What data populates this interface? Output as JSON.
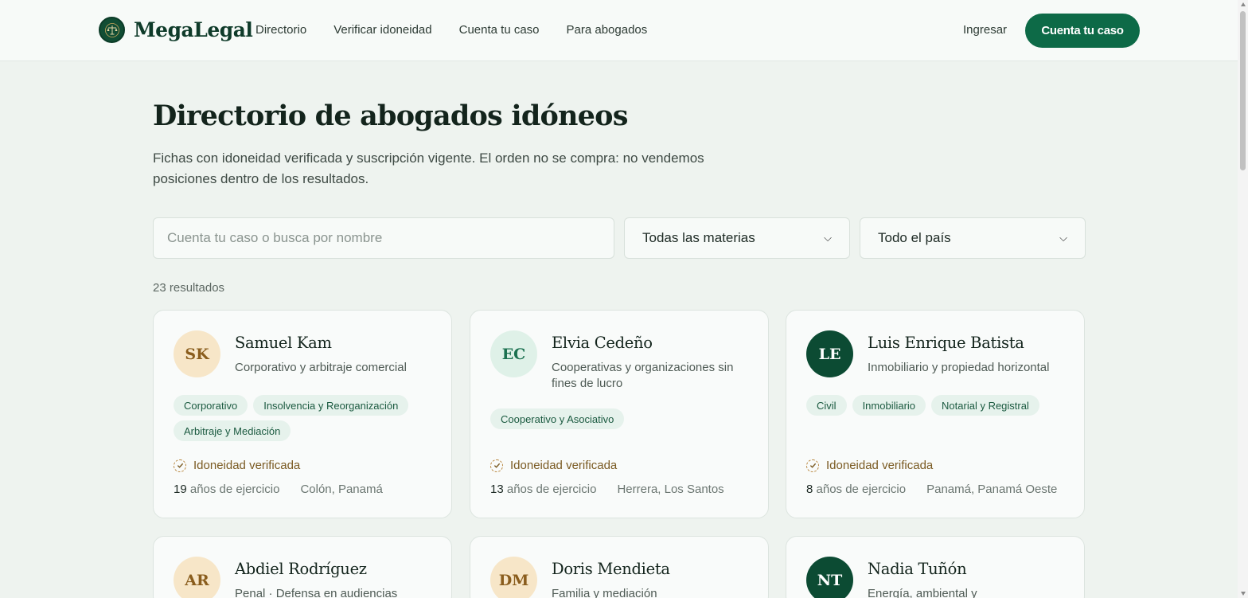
{
  "header": {
    "brand": "MegaLegal",
    "nav": [
      "Directorio",
      "Verificar idoneidad",
      "Cuenta tu caso",
      "Para abogados"
    ],
    "login": "Ingresar",
    "cta": "Cuenta tu caso"
  },
  "main": {
    "title": "Directorio de abogados idóneos",
    "subtitle": "Fichas con idoneidad verificada y suscripción vigente. El orden no se compra: no vendemos posiciones dentro de los resultados.",
    "search_placeholder": "Cuenta tu caso o busca por nombre",
    "materias_selected": "Todas las materias",
    "pais_selected": "Todo el país",
    "results_count": "23 resultados"
  },
  "verified_label": "Idoneidad verificada",
  "years_suffix": "años de ejercicio",
  "lawyers": [
    {
      "initials": "SK",
      "name": "Samuel Kam",
      "specialty": "Corporativo y arbitraje comercial",
      "tags": [
        "Corporativo",
        "Insolvencia y Reorganización",
        "Arbitraje y Mediación"
      ],
      "years": "19",
      "location": "Colón, Panamá",
      "avatar_color": "#f7e6c8"
    },
    {
      "initials": "EC",
      "name": "Elvia Cedeño",
      "specialty": "Cooperativas y organizaciones sin fines de lucro",
      "tags": [
        "Cooperativo y Asociativo"
      ],
      "years": "13",
      "location": "Herrera, Los Santos",
      "avatar_color": "#dff1e8"
    },
    {
      "initials": "LE",
      "name": "Luis Enrique Batista",
      "specialty": "Inmobiliario y propiedad horizontal",
      "tags": [
        "Civil",
        "Inmobiliario",
        "Notarial y Registral"
      ],
      "years": "8",
      "location": "Panamá, Panamá Oeste",
      "avatar_color": "#0c4b33"
    },
    {
      "initials": "AR",
      "name": "Abdiel Rodríguez",
      "specialty": "Penal · Defensa en audiencias",
      "avatar_color": "#f7e6c8"
    },
    {
      "initials": "DM",
      "name": "Doris Mendieta",
      "specialty": "Familia y mediación",
      "avatar_color": "#f7e6c8"
    },
    {
      "initials": "NT",
      "name": "Nadia Tuñón",
      "specialty": "Energía, ambiental y",
      "avatar_color": "#0c4b33"
    }
  ]
}
